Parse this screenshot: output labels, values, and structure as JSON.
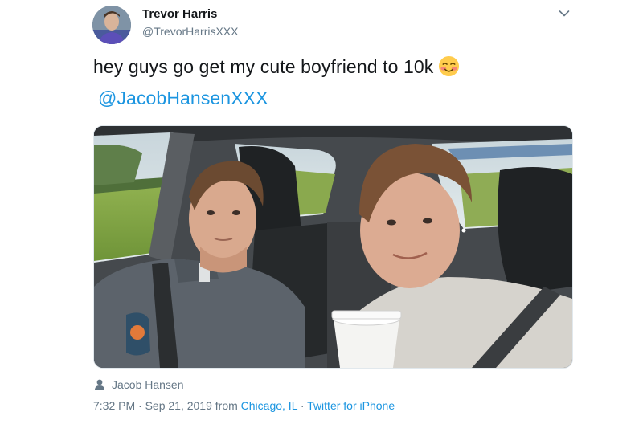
{
  "author": {
    "name": "Trevor Harris",
    "handle": "@TrevorHarrisXXX"
  },
  "tweet": {
    "text": "hey guys go get my cute boyfriend to 10k",
    "emoji": "smiling-face-with-blush-emoji",
    "mention": "@JacobHansenXXX"
  },
  "media": {
    "description_icon": "photo"
  },
  "tagged": {
    "icon": "person-icon",
    "name": "Jacob Hansen"
  },
  "meta": {
    "timestamp": "7:32 PM · Sep 21, 2019",
    "from_prefix": " from ",
    "location": "Chicago, IL",
    "separator": " · ",
    "client": "Twitter for iPhone"
  },
  "colors": {
    "link": "#1b95e0",
    "secondary_text": "#657786",
    "primary_text": "#14171a"
  }
}
